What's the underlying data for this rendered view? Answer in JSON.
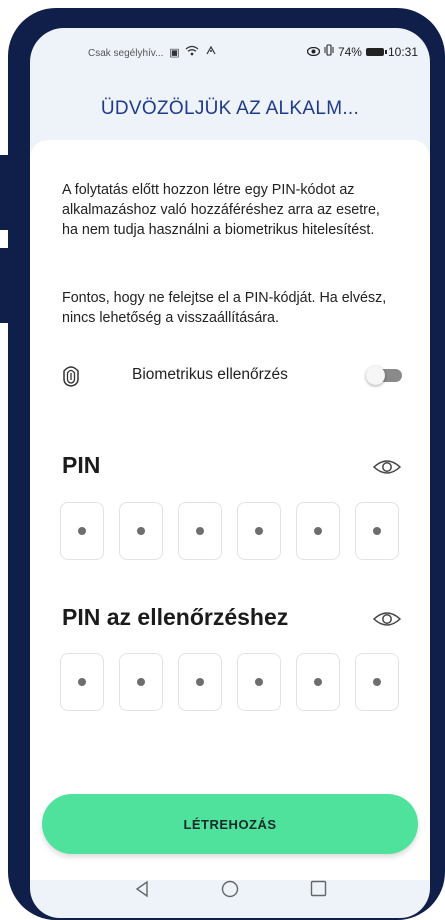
{
  "status_bar": {
    "carrier": "Csak segélyhív...",
    "battery_percent": "74%",
    "time": "10:31",
    "icons": [
      "sim-icon",
      "wifi-icon",
      "data-icon",
      "eye-comfort-icon",
      "vibrate-icon",
      "battery-icon"
    ]
  },
  "header": {
    "title": "ÜDVÖZÖLJÜK AZ ALKALM..."
  },
  "intro": {
    "text1": "A folytatás előtt hozzon létre egy PIN-kódot az alkalmazáshoz való hozzáféréshez arra az esetre, ha nem tudja használni a biometrikus hitelesítést.",
    "text2": "Fontos, hogy ne felejtse el a PIN-kódját. Ha elvész, nincs lehetőség a visszaállítására."
  },
  "biometric": {
    "label": "Biometrikus ellenőrzés",
    "enabled": false,
    "icon": "fingerprint-icon"
  },
  "pin": {
    "label": "PIN",
    "digits": 6,
    "icon": "eye-icon"
  },
  "pin_confirm": {
    "label": "PIN az ellenőrzéshez",
    "digits": 6,
    "icon": "eye-icon"
  },
  "cta": {
    "label": "LÉTREHOZÁS",
    "color": "#4ee29c"
  },
  "nav": {
    "icons": [
      "back-icon",
      "home-icon",
      "recent-apps-icon"
    ]
  },
  "colors": {
    "frame": "#0f1f4a",
    "title": "#1f3a8a",
    "screen_bg": "#eef3fa"
  }
}
